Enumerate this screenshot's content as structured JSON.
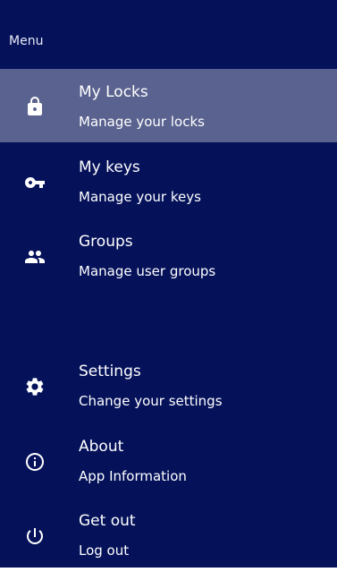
{
  "drawer": {
    "header": "Menu",
    "colors": {
      "background": "#05125a",
      "selected": "#5a628f",
      "text": "#ffffff"
    }
  },
  "items": [
    {
      "title": "My Locks",
      "subtitle": "Manage your locks",
      "icon": "lock-icon",
      "selected": true
    },
    {
      "title": "My keys",
      "subtitle": "Manage your keys",
      "icon": "key-icon",
      "selected": false
    },
    {
      "title": "Groups",
      "subtitle": "Manage user groups",
      "icon": "people-icon",
      "selected": false
    },
    {
      "title": "Settings",
      "subtitle": "Change your settings",
      "icon": "gear-icon",
      "selected": false
    },
    {
      "title": "About",
      "subtitle": "App Information",
      "icon": "info-icon",
      "selected": false
    },
    {
      "title": "Get out",
      "subtitle": "Log out",
      "icon": "power-icon",
      "selected": false
    }
  ]
}
